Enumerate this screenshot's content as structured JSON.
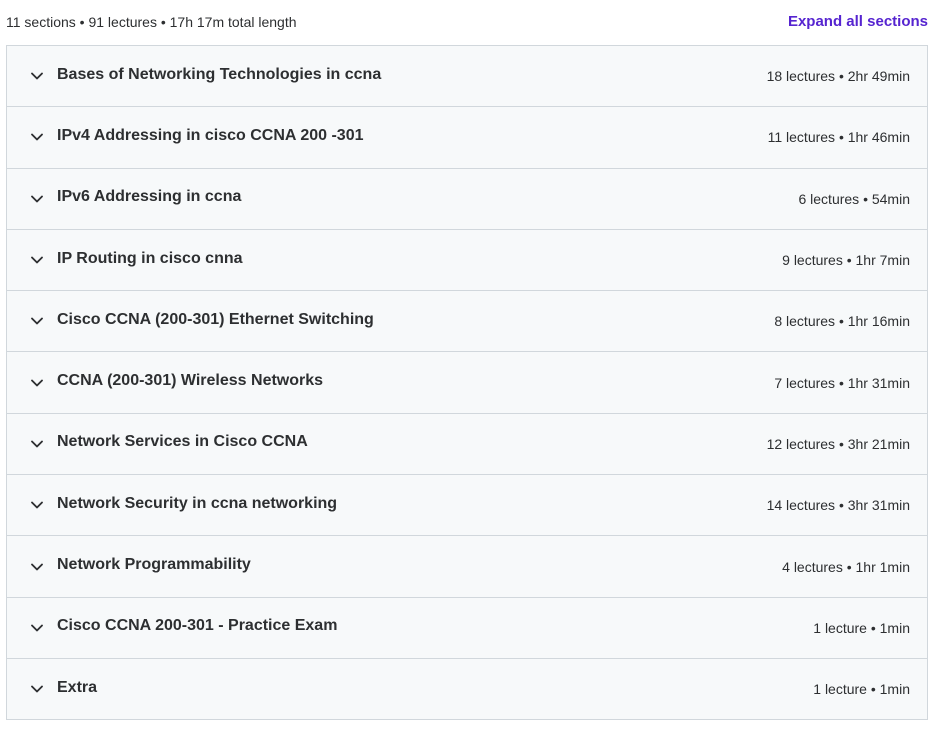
{
  "summary": {
    "text": "11 sections • 91 lectures • 17h 17m total length",
    "expand_label": "Expand all sections"
  },
  "colors": {
    "link": "#5624d0",
    "row_background": "#f7f9fa",
    "border": "#d1d7dc",
    "text": "#2d2f31"
  },
  "icons": {
    "section_toggle": "chevron-down-icon"
  },
  "sections": [
    {
      "title": "Bases of Networking Technologies in ccna",
      "meta": "18 lectures • 2hr 49min"
    },
    {
      "title": "IPv4 Addressing in cisco CCNA 200 -301",
      "meta": "11 lectures • 1hr 46min"
    },
    {
      "title": "IPv6 Addressing in ccna",
      "meta": "6 lectures • 54min"
    },
    {
      "title": "IP Routing in cisco cnna",
      "meta": "9 lectures • 1hr 7min"
    },
    {
      "title": "Cisco CCNA (200-301) Ethernet Switching",
      "meta": "8 lectures • 1hr 16min"
    },
    {
      "title": "CCNA (200-301) Wireless Networks",
      "meta": "7 lectures • 1hr 31min"
    },
    {
      "title": "Network Services in Cisco CCNA",
      "meta": "12 lectures • 3hr 21min"
    },
    {
      "title": "Network Security in ccna networking",
      "meta": "14 lectures • 3hr 31min"
    },
    {
      "title": "Network Programmability",
      "meta": "4 lectures • 1hr 1min"
    },
    {
      "title": "Cisco CCNA 200-301 - Practice Exam",
      "meta": "1 lecture • 1min"
    },
    {
      "title": "Extra",
      "meta": "1 lecture • 1min"
    }
  ]
}
